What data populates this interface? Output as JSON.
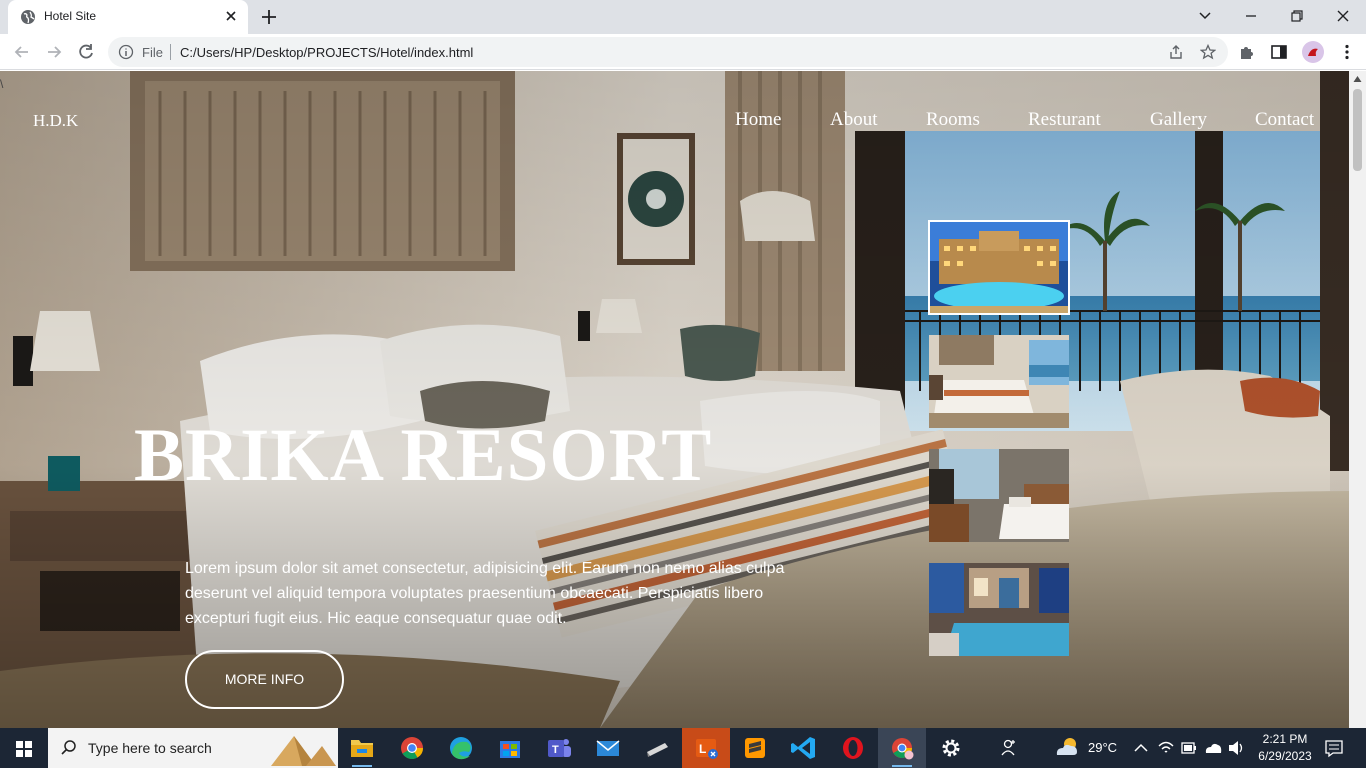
{
  "browser": {
    "tab_title": "Hotel Site",
    "file_label": "File",
    "url": "C:/Users/HP/Desktop/PROJECTS/Hotel/index.html"
  },
  "page": {
    "stray_char": "\\",
    "logo": "H.D.K",
    "nav": [
      "Home",
      "About",
      "Rooms",
      "Resturant",
      "Gallery",
      "Contact"
    ],
    "title": "BRIKA RESORT",
    "description": "Lorem ipsum dolor sit amet consectetur, adipisicing elit. Earum non nemo alias culpa deserunt vel aliquid tempora voluptates praesentium obcaecati. Perspiciatis libero excepturi fugit eius. Hic eaque consequatur quae odit.",
    "button_label": "MORE INFO",
    "thumbnails": [
      {
        "name": "resort-exterior-night",
        "active": true
      },
      {
        "name": "bedroom-ocean-view",
        "active": false
      },
      {
        "name": "hotel-room-desk",
        "active": false
      },
      {
        "name": "suite-pool",
        "active": false
      }
    ]
  },
  "taskbar": {
    "search_placeholder": "Type here to search",
    "apps": [
      "file-explorer",
      "chrome",
      "edge",
      "microsoft-store",
      "teams",
      "mail",
      "notes",
      "lens",
      "sublime-text",
      "vscode",
      "opera",
      "chrome-profile",
      "settings"
    ],
    "weather": "29°C",
    "time": "2:21 PM",
    "date": "6/29/2023"
  },
  "colors": {
    "chrome_tabbar": "#dee1e6",
    "taskbar": "#1c2635",
    "text_on_hero": "#ffffff"
  }
}
